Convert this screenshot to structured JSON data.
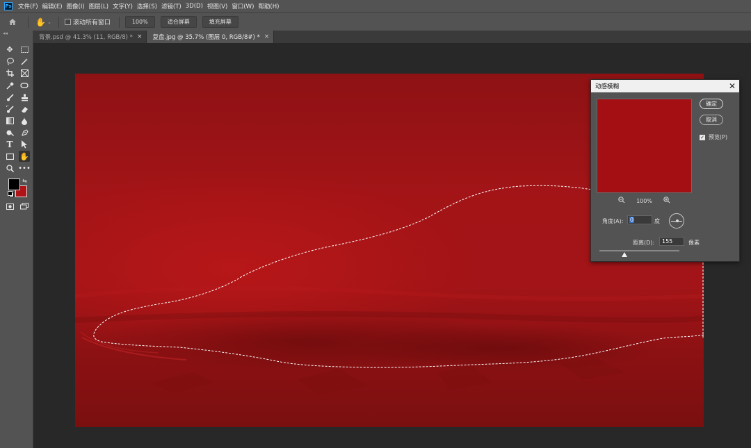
{
  "menubar": {
    "logo": "Ps",
    "items": [
      "文件(F)",
      "编辑(E)",
      "图像(I)",
      "图层(L)",
      "文字(Y)",
      "选择(S)",
      "滤镜(T)",
      "3D(D)",
      "视图(V)",
      "窗口(W)",
      "帮助(H)"
    ]
  },
  "options": {
    "scroll_all_label": "滚动所有窗口",
    "zoom_value": "100%",
    "fit_screen_label": "适合屏幕",
    "fill_screen_label": "填充屏幕"
  },
  "tabs": [
    {
      "label": "背景.psd @ 41.3% (11, RGB/8) *",
      "close": "×"
    },
    {
      "label": "复盘.jpg @ 35.7% (图层 0, RGB/8#) *",
      "close": "×"
    }
  ],
  "tools": [
    "move-icon",
    "marquee-icon",
    "lasso-icon",
    "magic-wand-icon",
    "crop-icon",
    "frame-icon",
    "eyedropper-icon",
    "spot-heal-icon",
    "brush-icon",
    "stamp-icon",
    "history-brush-icon",
    "eraser-icon",
    "gradient-icon",
    "blur-icon",
    "dodge-icon",
    "pen-icon",
    "type-icon",
    "path-select-icon",
    "rectangle-icon",
    "hand-icon",
    "zoom-icon",
    "more-icon"
  ],
  "colors": {
    "foreground": "#000000",
    "background": "#b01317",
    "canvas": "#a21417",
    "selection": "#ffffff"
  },
  "dialog": {
    "title": "动感模糊",
    "ok_label": "确定",
    "cancel_label": "取消",
    "preview_label": "预览(P)",
    "preview_checked": true,
    "zoom_percent": "100%",
    "angle_label": "角度(A):",
    "angle_value": "0",
    "angle_unit": "度",
    "distance_label": "距离(D):",
    "distance_value": "155",
    "distance_unit": "像素",
    "distance_slider_fraction": 0.31
  }
}
